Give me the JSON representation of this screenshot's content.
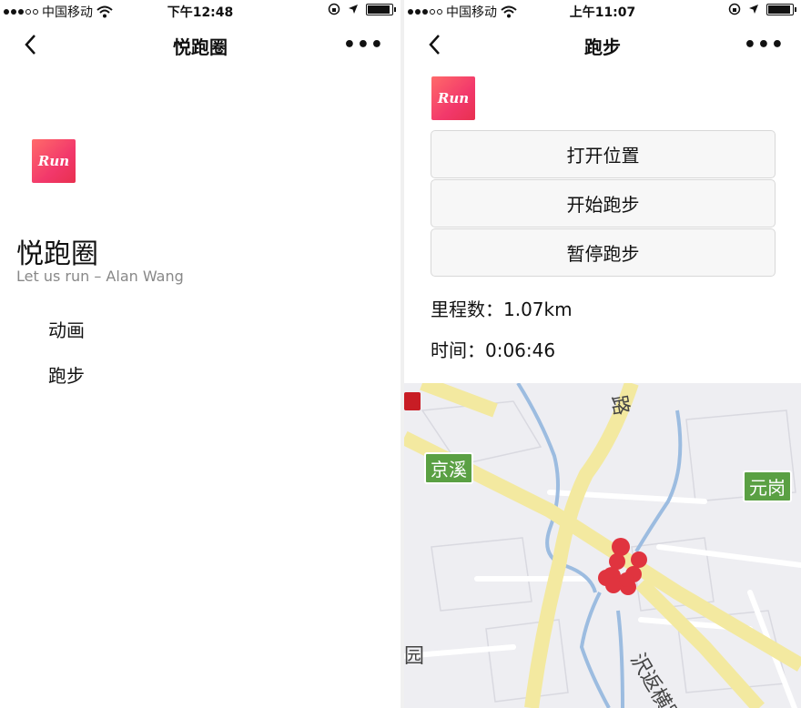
{
  "left": {
    "status": {
      "carrier": "中国移动",
      "time": "下午12:48"
    },
    "nav": {
      "title": "悦跑圈",
      "more": "•••"
    },
    "logo_text": "Run",
    "app_name": "悦跑圈",
    "app_subtitle": "Let us run – Alan Wang",
    "menu": [
      {
        "label": "动画"
      },
      {
        "label": "跑步"
      }
    ]
  },
  "right": {
    "status": {
      "carrier": "中国移动",
      "time": "上午11:07"
    },
    "nav": {
      "title": "跑步",
      "more": "•••"
    },
    "logo_text": "Run",
    "buttons": {
      "open_location": "打开位置",
      "start_run": "开始跑步",
      "pause_run": "暂停跑步"
    },
    "distance": "里程数：1.07km",
    "duration": "时间：0:06:46",
    "map": {
      "labels": {
        "jingxi": "京溪",
        "yuangang": "元岗",
        "yuan": "园",
        "road_top": "路",
        "road_bottom": "沢返横路"
      }
    }
  },
  "colors": {
    "accent": "#f2386b",
    "route": "#e0343f",
    "road": "#f3e9a0",
    "water": "#9cbce0",
    "park_label": "#5aa043"
  }
}
